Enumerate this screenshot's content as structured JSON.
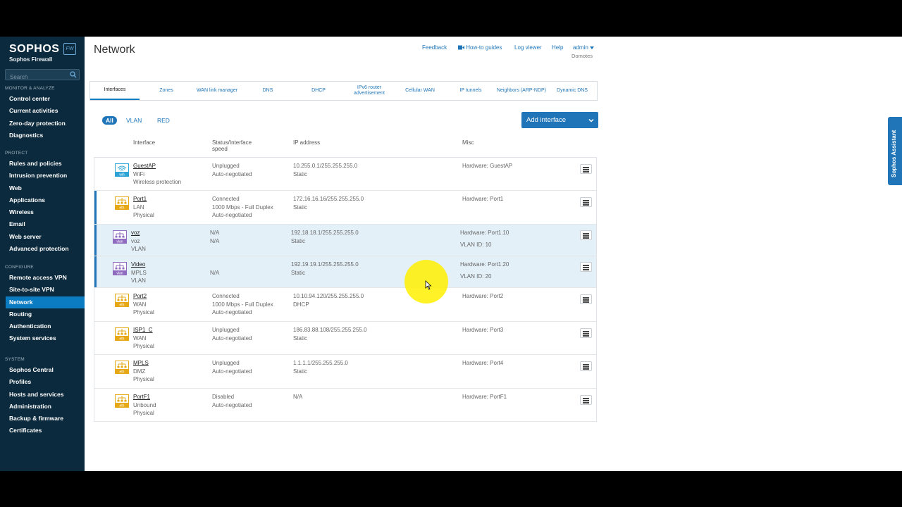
{
  "brand": {
    "name": "SOPHOS",
    "product": "Sophos Firewall",
    "badge": "FW"
  },
  "search": {
    "placeholder": "Search"
  },
  "sidebar": {
    "sections": [
      {
        "heading": "MONITOR & ANALYZE",
        "items": [
          "Control center",
          "Current activities",
          "Zero-day protection",
          "Diagnostics"
        ]
      },
      {
        "heading": "PROTECT",
        "items": [
          "Rules and policies",
          "Intrusion prevention",
          "Web",
          "Applications",
          "Wireless",
          "Email",
          "Web server",
          "Advanced protection"
        ]
      },
      {
        "heading": "CONFIGURE",
        "items": [
          "Remote access VPN",
          "Site-to-site VPN",
          "Network",
          "Routing",
          "Authentication",
          "System services"
        ]
      },
      {
        "heading": "SYSTEM",
        "items": [
          "Sophos Central",
          "Profiles",
          "Hosts and services",
          "Administration",
          "Backup & firmware",
          "Certificates"
        ]
      }
    ],
    "active_item": "Network"
  },
  "header": {
    "title": "Network",
    "links": {
      "feedback": "Feedback",
      "howto": "How-to guides",
      "log": "Log viewer",
      "help": "Help",
      "admin": "admin",
      "org": "Domotes"
    }
  },
  "tabs": [
    "Interfaces",
    "Zones",
    "WAN link manager",
    "DNS",
    "DHCP",
    "IPv6 router advertisement",
    "Cellular WAN",
    "IP tunnels",
    "Neighbors (ARP-NDP)",
    "Dynamic DNS"
  ],
  "active_tab": "Interfaces",
  "filters": [
    "All",
    "VLAN",
    "RED"
  ],
  "add_button": "Add interface",
  "table": {
    "headers": {
      "interface": "Interface",
      "status": "Status/Interface speed",
      "ip": "IP address",
      "misc": "Misc"
    },
    "rows": [
      {
        "icon": "wifi",
        "name": "GuestAP",
        "sub1": "WiFi",
        "sub2": "Wireless protection",
        "status": [
          "Unplugged",
          "Auto-negotiated"
        ],
        "ip": [
          "10.255.0.1/255.255.255.0",
          "Static"
        ],
        "misc": [
          "Hardware:  GuestAP"
        ]
      },
      {
        "icon": "eth",
        "name": "Port1",
        "sub1": "LAN",
        "sub2": "Physical",
        "status": [
          "Connected",
          "1000 Mbps - Full Duplex",
          "Auto-negotiated"
        ],
        "ip": [
          "172.16.16.16/255.255.255.0",
          "Static"
        ],
        "misc": [
          "Hardware:  Port1"
        ]
      },
      {
        "icon": "vlan",
        "name": "voz",
        "sub1": "voz",
        "sub2": "VLAN",
        "status": [
          "N/A",
          "N/A"
        ],
        "ip": [
          "192.18.18.1/255.255.255.0",
          "Static"
        ],
        "misc": [
          "Hardware:  Port1.10",
          "VLAN ID: 10"
        ]
      },
      {
        "icon": "vlan",
        "name": "Video",
        "sub1": "MPLS",
        "sub2": "VLAN",
        "status": [
          "",
          "N/A"
        ],
        "ip": [
          "192.19.19.1/255.255.255.0",
          "Static"
        ],
        "misc": [
          "Hardware:  Port1.20",
          "VLAN ID: 20"
        ]
      },
      {
        "icon": "eth",
        "name": "Port2",
        "sub1": "WAN",
        "sub2": "Physical",
        "status": [
          "Connected",
          "1000 Mbps - Full Duplex",
          "Auto-negotiated"
        ],
        "ip": [
          "10.10.94.120/255.255.255.0",
          "DHCP"
        ],
        "misc": [
          "Hardware:  Port2"
        ]
      },
      {
        "icon": "eth",
        "name": "ISP1_C",
        "sub1": "WAN",
        "sub2": "Physical",
        "status": [
          "Unplugged",
          "Auto-negotiated"
        ],
        "ip": [
          "186.83.88.108/255.255.255.0",
          "Static"
        ],
        "misc": [
          "Hardware:  Port3"
        ]
      },
      {
        "icon": "eth",
        "name": "MPLS",
        "sub1": "DMZ",
        "sub2": "Physical",
        "status": [
          "Unplugged",
          "Auto-negotiated"
        ],
        "ip": [
          "1.1.1.1/255.255.255.0",
          "Static"
        ],
        "misc": [
          "Hardware:  Port4"
        ]
      },
      {
        "icon": "eth",
        "name": "PortF1",
        "sub1": "Unbound",
        "sub2": "Physical",
        "status": [
          "Disabled",
          "Auto-negotiated"
        ],
        "ip": [
          "N/A"
        ],
        "misc": [
          "Hardware:  PortF1"
        ]
      }
    ]
  },
  "icon_labels": {
    "wifi": "wifi",
    "eth": "eth",
    "vlan": "vlan"
  },
  "assistant": "Sophos Assistant",
  "colors": {
    "sidebar": "#0b2a3d",
    "accent": "#1f75b7",
    "eth_icon": "#e6a817",
    "wifi_icon": "#2ea3d6",
    "vlan_icon": "#8e6bbf"
  }
}
